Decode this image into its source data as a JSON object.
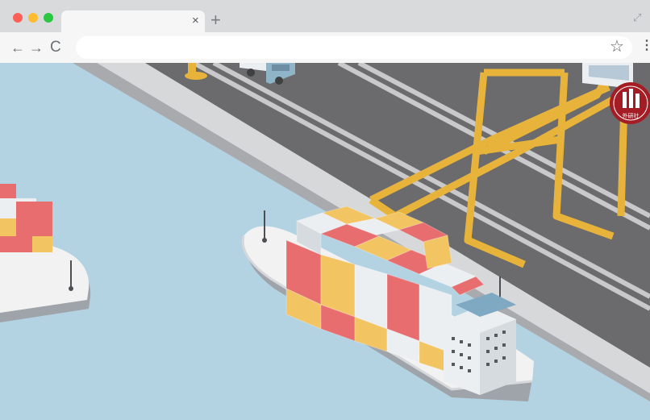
{
  "browser": {
    "tab": {
      "title": "",
      "close_glyph": "×"
    },
    "new_tab_glyph": "+",
    "fullscreen_glyph": "⤢",
    "nav": {
      "back_glyph": "←",
      "forward_glyph": "→",
      "reload_glyph": "C"
    },
    "address_bar": {
      "url": "",
      "placeholder": ""
    },
    "bookmark_glyph": "☆",
    "menu_glyph": "⋮",
    "traffic_lights": {
      "close": "#ff5f57",
      "minimize": "#febc2e",
      "zoom": "#28c840"
    }
  },
  "illustration": {
    "subject": "container port with cargo ships, gantry crane and truck",
    "colors": {
      "water": "#b3d3e3",
      "quay": "#6b6b6d",
      "crane": "#e7b33a",
      "ship_hull": "#f2f2f2",
      "container_red": "#e86d6f",
      "container_yellow": "#f2c462",
      "container_white": "#eceff2",
      "badge": "#a51d24"
    },
    "badge_text": "外研社"
  }
}
